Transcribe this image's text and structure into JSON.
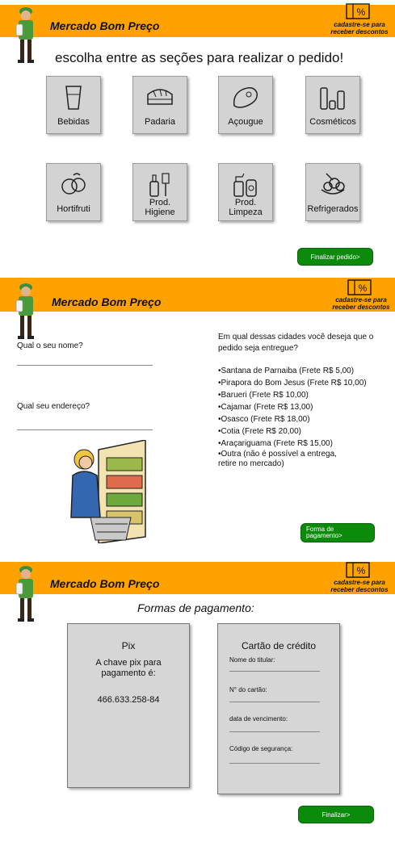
{
  "brand": {
    "name": "Mercado Bom Preço",
    "promo": [
      "cadastre-se para",
      "receber descontos"
    ]
  },
  "screen1": {
    "headline": "escolha entre as seções para realizar o pedido!",
    "categories": [
      {
        "label": "Bebidas",
        "icon": "glass-icon"
      },
      {
        "label": "Padaria",
        "icon": "bread-icon"
      },
      {
        "label": "Açougue",
        "icon": "meat-icon"
      },
      {
        "label": "Cosméticos",
        "icon": "cosmetics-icon"
      },
      {
        "label": "Hortifruti",
        "icon": "fruits-icon"
      },
      {
        "label": "Prod. Higiene",
        "icon": "hygiene-icon"
      },
      {
        "label": "Prod. Limpeza",
        "icon": "cleaning-icon"
      },
      {
        "label": "Refrigerados",
        "icon": "ice-cream-icon"
      }
    ],
    "finish_button": "Finalizar pedido>"
  },
  "screen2": {
    "name_question": "Qual o seu nome?",
    "address_question": "Qual seu endereço?",
    "city_question": "Em qual dessas cidades você deseja que o pedido seja entregue?",
    "cities": [
      "•Santana de Parnaiba (Frete R$ 5,00)",
      "•Pirapora do Bom Jesus (Frete R$ 10,00)",
      "•Barueri (Frete R$ 10,00)",
      "•Cajamar (Frete R$ 13,00)",
      "•Osasco (Frete R$ 18,00)",
      "•Cotia (Frete R$ 20,00)",
      "•Araçariguama (Frete R$ 15,00)",
      "•Outra (não é possível a entrega, retire no mercado)"
    ],
    "payment_button": "Forma de pagamento>"
  },
  "screen3": {
    "title": "Formas de pagamento:",
    "pix": {
      "title": "Pix",
      "text": "A chave pix para pagamento é:",
      "key": "466.633.258-84"
    },
    "card": {
      "title": "Cartão de crédito",
      "fields": [
        "Nome do titular:",
        "N° do cartão:",
        "data de vencimento:",
        "Código de segurança:"
      ]
    },
    "finish_button": "Finalizar>"
  }
}
